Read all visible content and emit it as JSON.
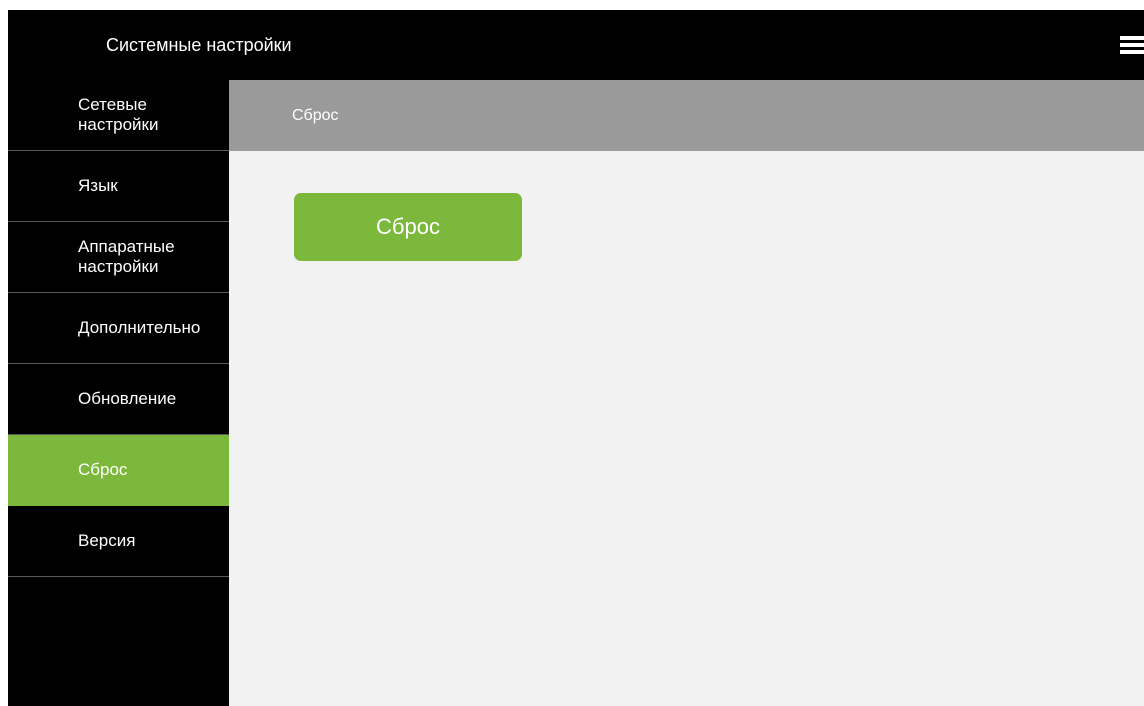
{
  "header": {
    "title": "Системные настройки",
    "menu_icon": "hamburger-menu-icon"
  },
  "sidebar": {
    "items": [
      {
        "label": "Сетевые\nнастройки",
        "active": false
      },
      {
        "label": "Язык",
        "active": false
      },
      {
        "label": "Аппаратные\nнастройки",
        "active": false
      },
      {
        "label": "Дополнительно",
        "active": false
      },
      {
        "label": "Обновление",
        "active": false
      },
      {
        "label": "Сброс",
        "active": true
      },
      {
        "label": "Версия",
        "active": false
      }
    ]
  },
  "section": {
    "title": "Сброс"
  },
  "main": {
    "reset_button_label": "Сброс"
  },
  "colors": {
    "accent": "#7cb83b",
    "sidebar_bg": "#000000",
    "section_header_bg": "#9a9a9a",
    "content_bg": "#f2f2f2"
  }
}
